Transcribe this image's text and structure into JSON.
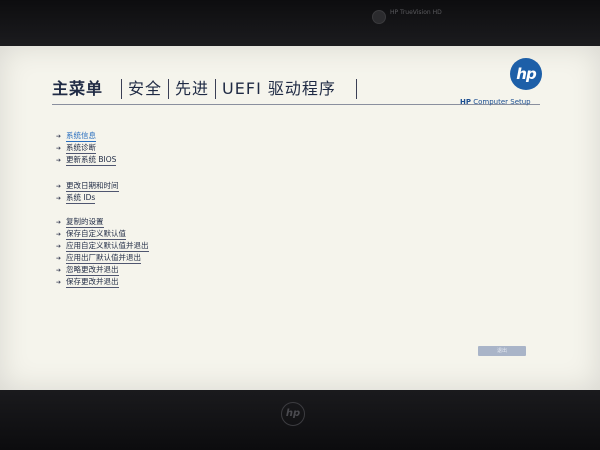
{
  "camera_label": "HP TrueVision HD",
  "tabs": [
    "主菜单",
    "安全",
    "先进",
    "UEFI 驱动程序"
  ],
  "brand": {
    "logo": "hp",
    "name_bold": "HP",
    "name_rest": " Computer Setup"
  },
  "menu": {
    "group1": [
      "系统信息",
      "系统诊断",
      "更新系统 BIOS"
    ],
    "group2": [
      "更改日期和时间",
      "系统 IDs"
    ],
    "group3": [
      "复制的设置",
      "保存自定义默认值",
      "应用自定义默认值并退出",
      "应用出厂默认值并退出",
      "忽略更改并退出",
      "保存更改并退出"
    ]
  },
  "selected_item": "系统信息",
  "exit_button": "退出",
  "bezel_logo": "hp",
  "icons": {
    "arrow": "right-arrow-icon",
    "webcam": "webcam-icon"
  },
  "colors": {
    "screen": "#f5f4ec",
    "tab_text": "#1f2a44",
    "accent": "#2a6fbf",
    "hp_blue": "#1d5fa8"
  }
}
